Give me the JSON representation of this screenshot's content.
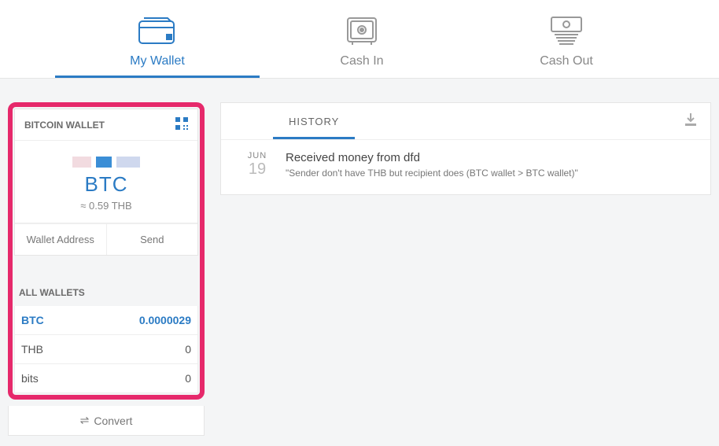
{
  "tabs": {
    "wallet": "My Wallet",
    "cashin": "Cash In",
    "cashout": "Cash Out"
  },
  "wallet_card": {
    "header": "BITCOIN WALLET",
    "symbol": "BTC",
    "approx": "≈ 0.59 THB",
    "address_btn": "Wallet Address",
    "send_btn": "Send"
  },
  "all_wallets": {
    "title": "ALL WALLETS",
    "rows": [
      {
        "name": "BTC",
        "value": "0.0000029"
      },
      {
        "name": "THB",
        "value": "0"
      },
      {
        "name": "bits",
        "value": "0"
      }
    ],
    "convert": "Convert"
  },
  "history": {
    "tab": "HISTORY",
    "item": {
      "month": "JUN",
      "day": "19",
      "title": "Received money from dfd",
      "sub": "\"Sender don't have THB but recipient does (BTC wallet > BTC wallet)\""
    }
  }
}
